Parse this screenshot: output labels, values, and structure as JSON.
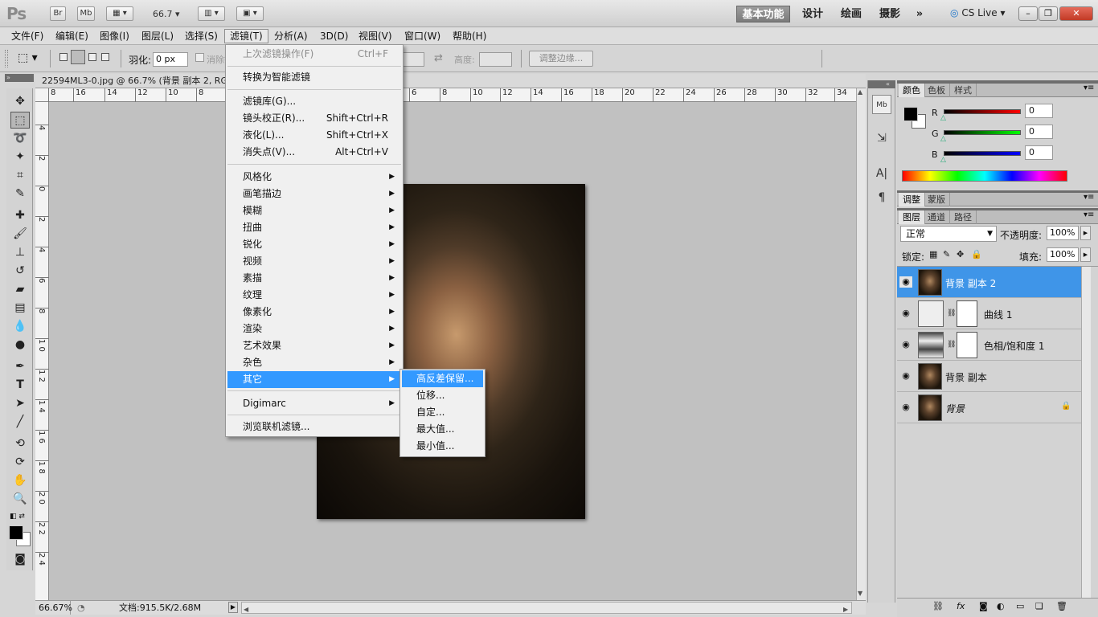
{
  "app": {
    "logo": "Ps",
    "bridge": "Br",
    "minibridge": "Mb",
    "zoom": "66.7"
  },
  "workspace": {
    "basic": "基本功能",
    "design": "设计",
    "painting": "绘画",
    "photography": "摄影",
    "more": "»",
    "cslive": "CS Live"
  },
  "window": {
    "minimize": "–",
    "restore": "❐",
    "close": "✕"
  },
  "menu": [
    "文件(F)",
    "编辑(E)",
    "图像(I)",
    "图层(L)",
    "选择(S)",
    "滤镜(T)",
    "分析(A)",
    "3D(D)",
    "视图(V)",
    "窗口(W)",
    "帮助(H)"
  ],
  "options": {
    "feather_label": "羽化:",
    "feather_value": "0 px",
    "antialias": "消除锯齿",
    "height_label": "高度:",
    "refine_edge": "调整边缘..."
  },
  "document": {
    "tab": "22594ML3-0.jpg @ 66.7% (背景 副本 2, RGB/8) *",
    "zoom": "66.67%",
    "doc_info": "文档:915.5K/2.68M"
  },
  "ruler_top": [
    "8",
    "16",
    "14",
    "12",
    "10",
    "8",
    "6",
    "8",
    "10",
    "12",
    "14",
    "16",
    "18",
    "20",
    "22",
    "24",
    "26",
    "28",
    "30",
    "32",
    "34"
  ],
  "ruler_left": [
    "4",
    "2",
    "0",
    "2",
    "4",
    "6",
    "8",
    "1 0",
    "1 2",
    "1 4",
    "1 6",
    "1 8",
    "2 0",
    "2 2",
    "2 4"
  ],
  "filter_menu": {
    "last_filter": {
      "label": "上次滤镜操作(F)",
      "shortcut": "Ctrl+F"
    },
    "smart": "转换为智能滤镜",
    "gallery": "滤镜库(G)...",
    "lens": {
      "label": "镜头校正(R)...",
      "shortcut": "Shift+Ctrl+R"
    },
    "liquify": {
      "label": "液化(L)...",
      "shortcut": "Shift+Ctrl+X"
    },
    "vanishing": {
      "label": "消失点(V)...",
      "shortcut": "Alt+Ctrl+V"
    },
    "groups": [
      "风格化",
      "画笔描边",
      "模糊",
      "扭曲",
      "锐化",
      "视频",
      "素描",
      "纹理",
      "像素化",
      "渲染",
      "艺术效果",
      "杂色",
      "其它"
    ],
    "digimarc": "Digimarc",
    "browse": "浏览联机滤镜..."
  },
  "other_submenu": [
    "高反差保留...",
    "位移...",
    "自定...",
    "最大值...",
    "最小值..."
  ],
  "color_panel": {
    "tabs": [
      "颜色",
      "色板",
      "样式"
    ],
    "r": "0",
    "g": "0",
    "b": "0",
    "r_label": "R",
    "g_label": "G",
    "b_label": "B"
  },
  "adjust_panel": {
    "tabs": [
      "调整",
      "蒙版"
    ]
  },
  "layers_panel": {
    "tabs": [
      "图层",
      "通道",
      "路径"
    ],
    "blend": "正常",
    "opacity_label": "不透明度:",
    "opacity": "100%",
    "lock_label": "锁定:",
    "fill_label": "填充:",
    "fill": "100%"
  },
  "layers": [
    {
      "name": "背景 副本 2",
      "selected": true
    },
    {
      "name": "曲线 1",
      "adjust": "curves"
    },
    {
      "name": "色相/饱和度 1",
      "adjust": "huesat"
    },
    {
      "name": "背景 副本"
    },
    {
      "name": "背景",
      "locked": true
    }
  ],
  "colors": {
    "highlight": "#3399ff",
    "layer_selected": "#3f95e8"
  }
}
